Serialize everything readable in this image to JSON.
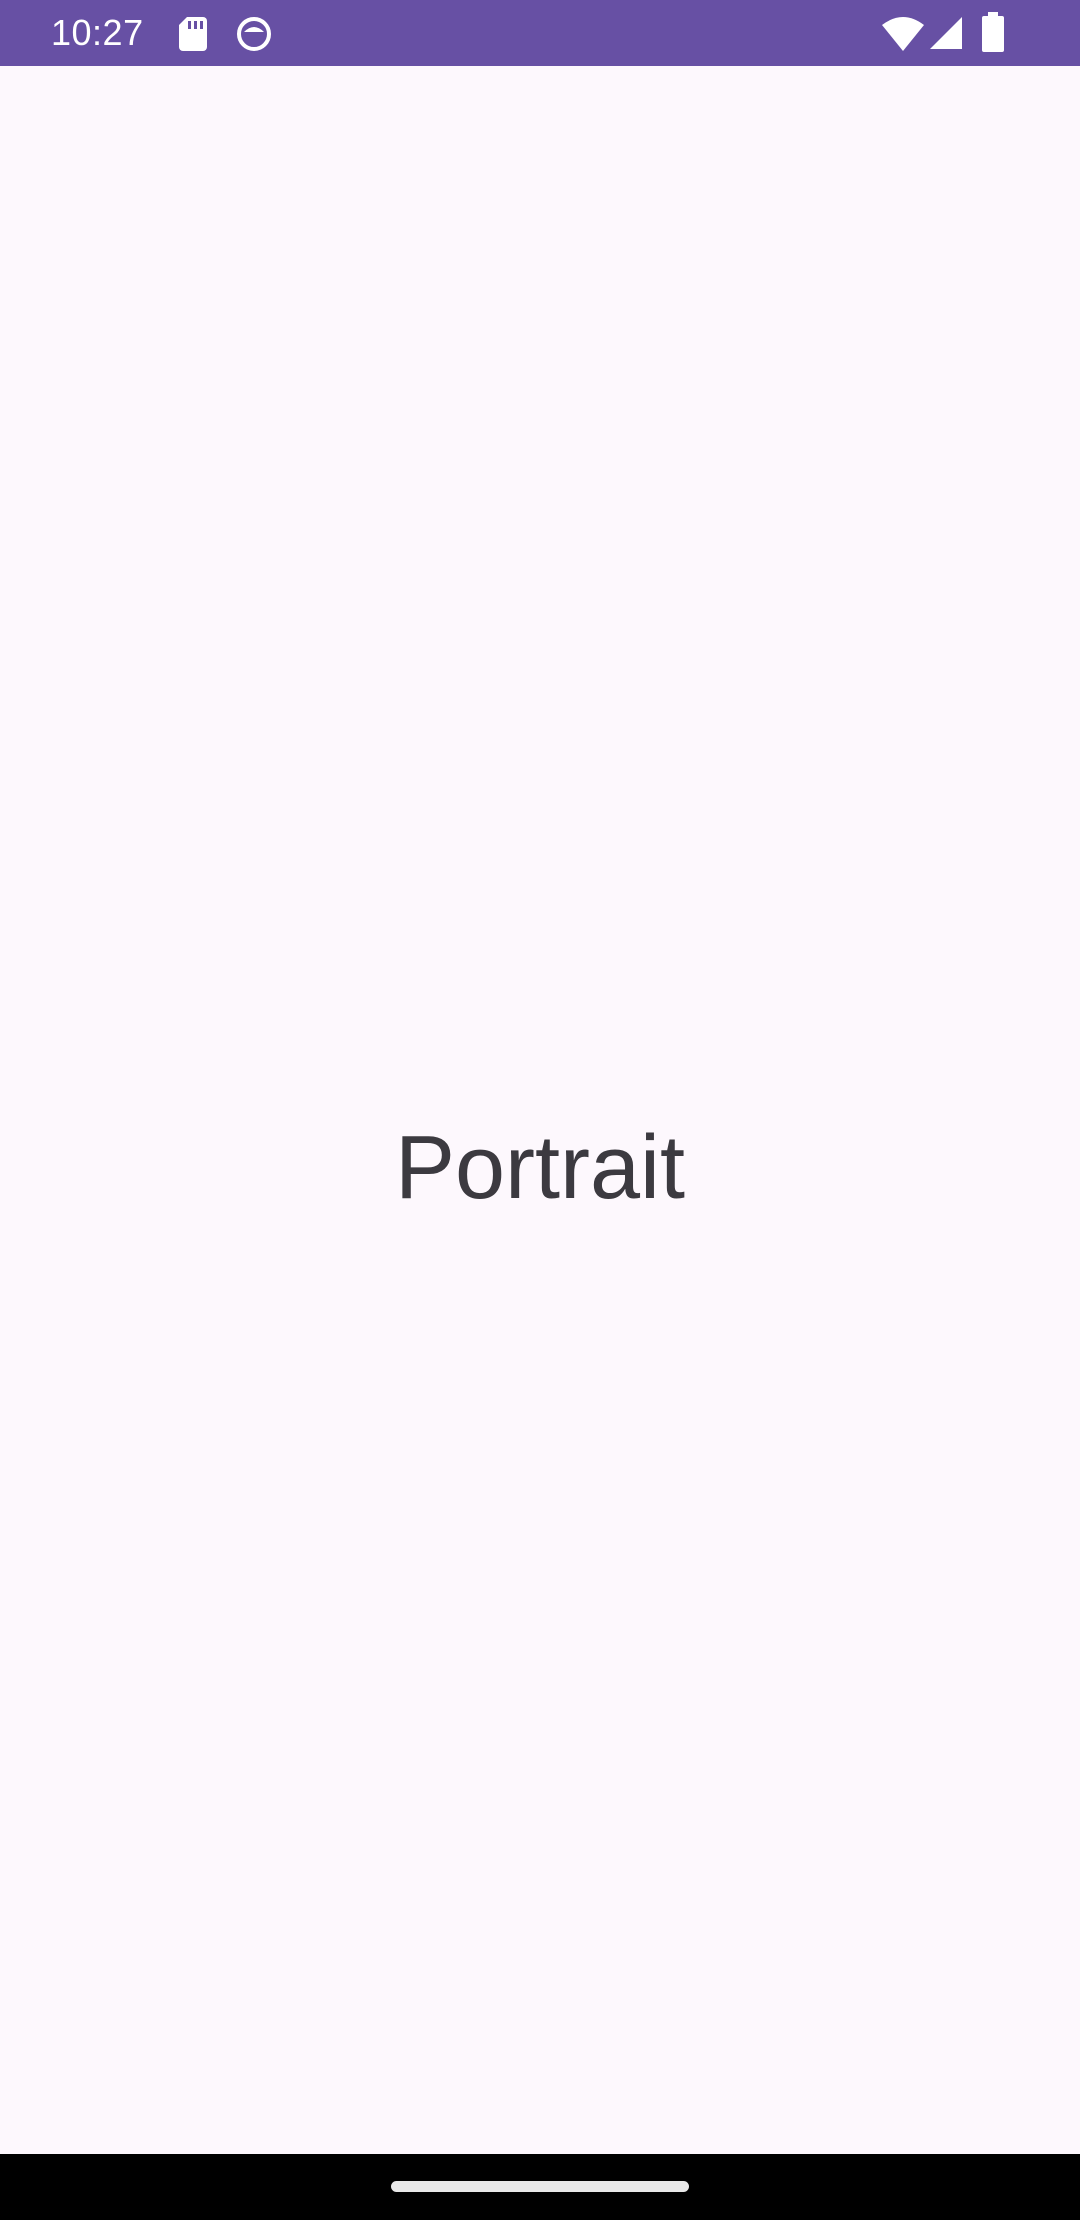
{
  "status_bar": {
    "time": "10:27",
    "icons": [
      "sd-card-icon",
      "sync-icon",
      "wifi-icon",
      "signal-icon",
      "battery-icon"
    ],
    "background": "#6750a4"
  },
  "main": {
    "label": "Portrait",
    "background": "#fdf8fd",
    "text_color": "#3c3a40"
  },
  "nav_bar": {
    "background": "#000000"
  }
}
